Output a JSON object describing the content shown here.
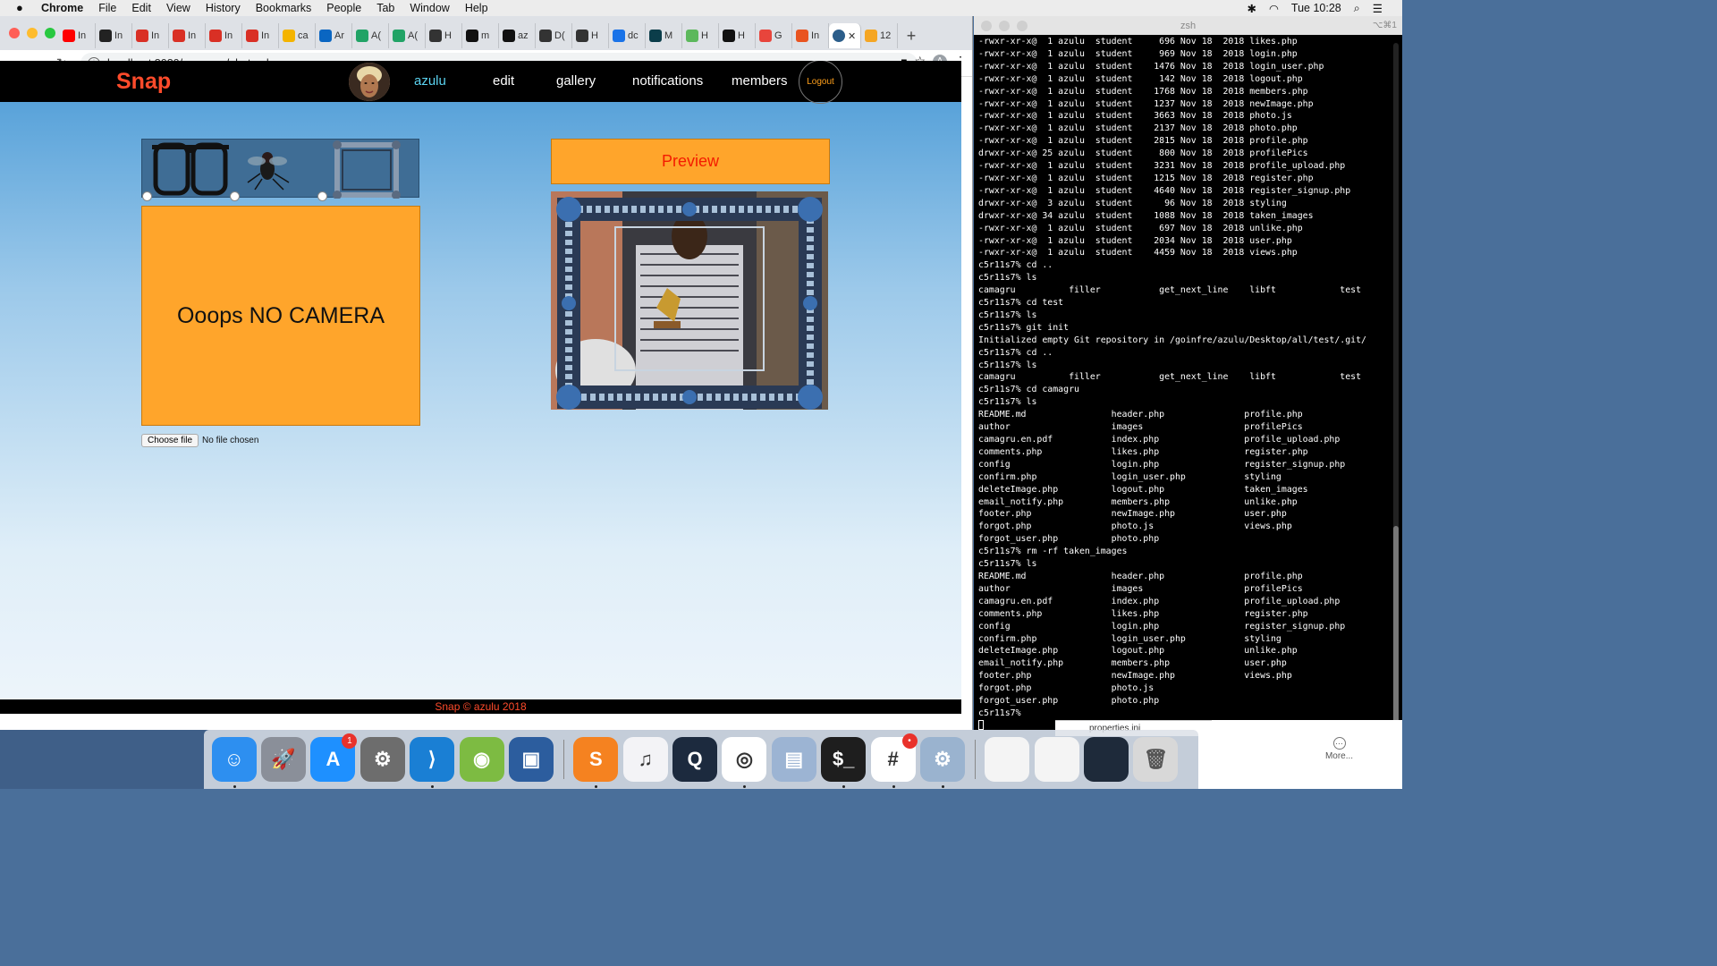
{
  "menubar": {
    "app": "Chrome",
    "items": [
      "File",
      "Edit",
      "View",
      "History",
      "Bookmarks",
      "People",
      "Tab",
      "Window",
      "Help"
    ],
    "clock": "Tue 10:28"
  },
  "browser": {
    "tabs": [
      {
        "label": "In",
        "color": "#ff0000"
      },
      {
        "label": "In",
        "color": "#222222"
      },
      {
        "label": "In",
        "color": "#d93025"
      },
      {
        "label": "In",
        "color": "#d93025"
      },
      {
        "label": "In",
        "color": "#d93025"
      },
      {
        "label": "In",
        "color": "#d93025"
      },
      {
        "label": "ca",
        "color": "#f4b400"
      },
      {
        "label": "Ar",
        "color": "#0a66c2"
      },
      {
        "label": "A(",
        "color": "#21a366"
      },
      {
        "label": "A(",
        "color": "#21a366"
      },
      {
        "label": "H",
        "color": "#333333"
      },
      {
        "label": "m",
        "color": "#111111"
      },
      {
        "label": "az",
        "color": "#111111"
      },
      {
        "label": "D(",
        "color": "#333333"
      },
      {
        "label": "H",
        "color": "#333333"
      },
      {
        "label": "dc",
        "color": "#1a73e8"
      },
      {
        "label": "M",
        "color": "#0b3d4a"
      },
      {
        "label": "H",
        "color": "#5cb85c"
      },
      {
        "label": "H",
        "color": "#111111"
      },
      {
        "label": "G",
        "color": "#e8453c"
      },
      {
        "label": "In",
        "color": "#e95420"
      }
    ],
    "active_tab_label": "",
    "extra_tab_label": "12",
    "url": "localhost:8080/camagru/photo.php"
  },
  "site": {
    "brand": "Snap",
    "nav": {
      "username": "azulu",
      "edit": "edit",
      "gallery": "gallery",
      "notifications": "notifications",
      "members": "members",
      "logout": "Logout"
    },
    "camera_message": "Ooops NO CAMERA",
    "file_button": "Choose file",
    "file_status": "No file chosen",
    "preview_button": "Preview",
    "footer": "Snap © azulu 2018",
    "stickers": [
      "glasses",
      "fly",
      "frame"
    ]
  },
  "terminal": {
    "title": "zsh",
    "shortcut": "⌥⌘1",
    "lines": [
      "-rwxr-xr-x@  1 azulu  student     696 Nov 18  2018 likes.php",
      "-rwxr-xr-x@  1 azulu  student     969 Nov 18  2018 login.php",
      "-rwxr-xr-x@  1 azulu  student    1476 Nov 18  2018 login_user.php",
      "-rwxr-xr-x@  1 azulu  student     142 Nov 18  2018 logout.php",
      "-rwxr-xr-x@  1 azulu  student    1768 Nov 18  2018 members.php",
      "-rwxr-xr-x@  1 azulu  student    1237 Nov 18  2018 newImage.php",
      "-rwxr-xr-x@  1 azulu  student    3663 Nov 18  2018 photo.js",
      "-rwxr-xr-x@  1 azulu  student    2137 Nov 18  2018 photo.php",
      "-rwxr-xr-x@  1 azulu  student    2815 Nov 18  2018 profile.php",
      "drwxr-xr-x@ 25 azulu  student     800 Nov 18  2018 profilePics",
      "-rwxr-xr-x@  1 azulu  student    3231 Nov 18  2018 profile_upload.php",
      "-rwxr-xr-x@  1 azulu  student    1215 Nov 18  2018 register.php",
      "-rwxr-xr-x@  1 azulu  student    4640 Nov 18  2018 register_signup.php",
      "drwxr-xr-x@  3 azulu  student      96 Nov 18  2018 styling",
      "drwxr-xr-x@ 34 azulu  student    1088 Nov 18  2018 taken_images",
      "-rwxr-xr-x@  1 azulu  student     697 Nov 18  2018 unlike.php",
      "-rwxr-xr-x@  1 azulu  student    2034 Nov 18  2018 user.php",
      "-rwxr-xr-x@  1 azulu  student    4459 Nov 18  2018 views.php",
      "c5r11s7% cd ..",
      "c5r11s7% ls",
      "camagru          filler           get_next_line    libft            test",
      "c5r11s7% cd test",
      "c5r11s7% ls",
      "c5r11s7% git init",
      "Initialized empty Git repository in /goinfre/azulu/Desktop/all/test/.git/",
      "c5r11s7% cd ..",
      "c5r11s7% ls",
      "camagru          filler           get_next_line    libft            test",
      "c5r11s7% cd camagru",
      "c5r11s7% ls",
      "README.md                header.php               profile.php",
      "author                   images                   profilePics",
      "camagru.en.pdf           index.php                profile_upload.php",
      "comments.php             likes.php                register.php",
      "config                   login.php                register_signup.php",
      "confirm.php              login_user.php           styling",
      "deleteImage.php          logout.php               taken_images",
      "email_notify.php         members.php              unlike.php",
      "footer.php               newImage.php             user.php",
      "forgot.php               photo.js                 views.php",
      "forgot_user.php          photo.php",
      "c5r11s7% rm -rf taken_images",
      "c5r11s7% ls",
      "README.md                header.php               profile.php",
      "author                   images                   profilePics",
      "camagru.en.pdf           index.php                profile_upload.php",
      "comments.php             likes.php                register.php",
      "config                   login.php                register_signup.php",
      "confirm.php              login_user.php           styling",
      "deleteImage.php          logout.php               unlike.php",
      "email_notify.php         members.php              user.php",
      "footer.php               newImage.php             views.php",
      "forgot.php               photo.js",
      "forgot_user.php          photo.php",
      "c5r11s7% "
    ]
  },
  "finder_strip": "properties.ini",
  "dock": {
    "items": [
      {
        "name": "finder",
        "glyph": "☺",
        "color": "#2d8ff0",
        "running": true
      },
      {
        "name": "launchpad",
        "glyph": "🚀",
        "color": "#8a8f99",
        "running": false
      },
      {
        "name": "app-store",
        "glyph": "A",
        "color": "#1e90ff",
        "running": false,
        "badge": "1"
      },
      {
        "name": "system-preferences",
        "glyph": "⚙",
        "color": "#6d6d6d",
        "running": false
      },
      {
        "name": "vscode",
        "glyph": "⟩",
        "color": "#1a7fd4",
        "running": true
      },
      {
        "name": "android-studio",
        "glyph": "◉",
        "color": "#7dbb42",
        "running": false
      },
      {
        "name": "virtualbox",
        "glyph": "▣",
        "color": "#2c5d9e",
        "running": false
      },
      {
        "name": "sublime-text",
        "glyph": "S",
        "color": "#f58220",
        "running": true
      },
      {
        "name": "itunes",
        "glyph": "♫",
        "color": "#f3f3f6",
        "running": false
      },
      {
        "name": "quicktime",
        "glyph": "Q",
        "color": "#1c2a3e",
        "running": false
      },
      {
        "name": "chrome",
        "glyph": "◎",
        "color": "#ffffff",
        "running": true
      },
      {
        "name": "preview",
        "glyph": "▤",
        "color": "#9cb4d3",
        "running": false
      },
      {
        "name": "terminal",
        "glyph": "$_",
        "color": "#1e1e1e",
        "running": true
      },
      {
        "name": "slack",
        "glyph": "#",
        "color": "#ffffff",
        "running": true,
        "badge": "•"
      },
      {
        "name": "managed-software-center",
        "glyph": "⚙",
        "color": "#9ab3cf",
        "running": true
      }
    ],
    "more_label": "More..."
  }
}
